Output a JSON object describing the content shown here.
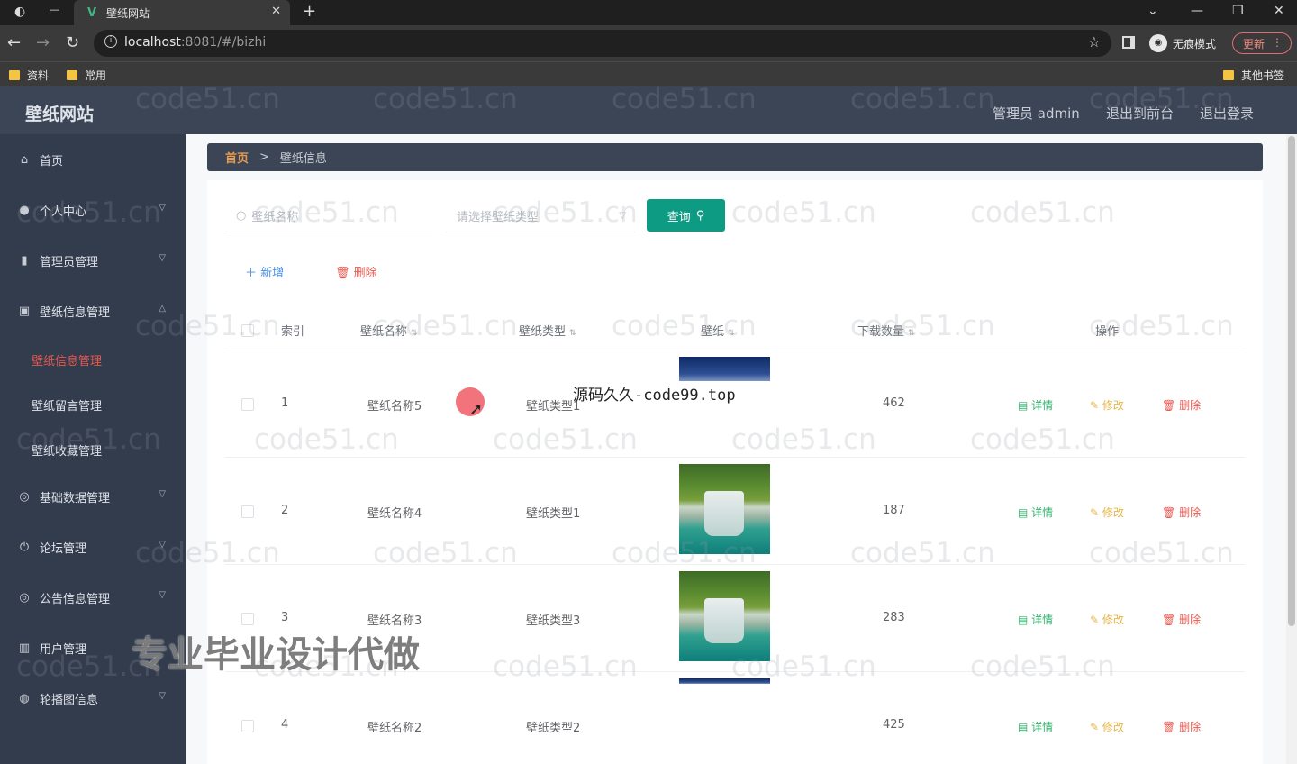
{
  "browser": {
    "tab_title": "壁纸网站",
    "url_host": "localhost",
    "url_rest": ":8081/#/bizhi",
    "incognito_label": "无痕模式",
    "update_label": "更新",
    "bookmarks": [
      "资料",
      "常用"
    ],
    "other_bookmarks": "其他书签"
  },
  "header": {
    "brand": "壁纸网站",
    "admin": "管理员 admin",
    "to_front": "退出到前台",
    "logout": "退出登录"
  },
  "sidebar": {
    "items": [
      {
        "label": "首页",
        "icon": "home-icon"
      },
      {
        "label": "个人中心",
        "icon": "user-icon"
      },
      {
        "label": "管理员管理",
        "icon": "chart-icon"
      },
      {
        "label": "壁纸信息管理",
        "icon": "image-icon"
      },
      {
        "label": "基础数据管理",
        "icon": "compass-icon"
      },
      {
        "label": "论坛管理",
        "icon": "power-icon"
      },
      {
        "label": "公告信息管理",
        "icon": "compass-icon"
      },
      {
        "label": "用户管理",
        "icon": "bars-icon"
      },
      {
        "label": "轮播图信息",
        "icon": "globe-icon"
      }
    ],
    "sub_items": [
      "壁纸信息管理",
      "壁纸留言管理",
      "壁纸收藏管理"
    ]
  },
  "breadcrumb": {
    "home": "首页",
    "sep": ">",
    "current": "壁纸信息"
  },
  "search": {
    "name_placeholder": "壁纸名称",
    "type_placeholder": "请选择壁纸类型",
    "query_label": "查询"
  },
  "actions": {
    "add": "新增",
    "delete": "删除"
  },
  "table": {
    "headers": [
      "索引",
      "壁纸名称",
      "壁纸类型",
      "壁纸",
      "下载数量",
      "操作"
    ],
    "rows": [
      {
        "index": "1",
        "name": "壁纸名称5",
        "type": "壁纸类型1",
        "downloads": "462"
      },
      {
        "index": "2",
        "name": "壁纸名称4",
        "type": "壁纸类型1",
        "downloads": "187"
      },
      {
        "index": "3",
        "name": "壁纸名称3",
        "type": "壁纸类型3",
        "downloads": "283"
      },
      {
        "index": "4",
        "name": "壁纸名称2",
        "type": "壁纸类型2",
        "downloads": "425"
      }
    ],
    "op_detail": "详情",
    "op_edit": "修改",
    "op_delete": "删除"
  },
  "overlays": {
    "watermark": "code51.cn",
    "center_text": "源码久久-code99.top",
    "banner": "专业毕业设计代做"
  }
}
